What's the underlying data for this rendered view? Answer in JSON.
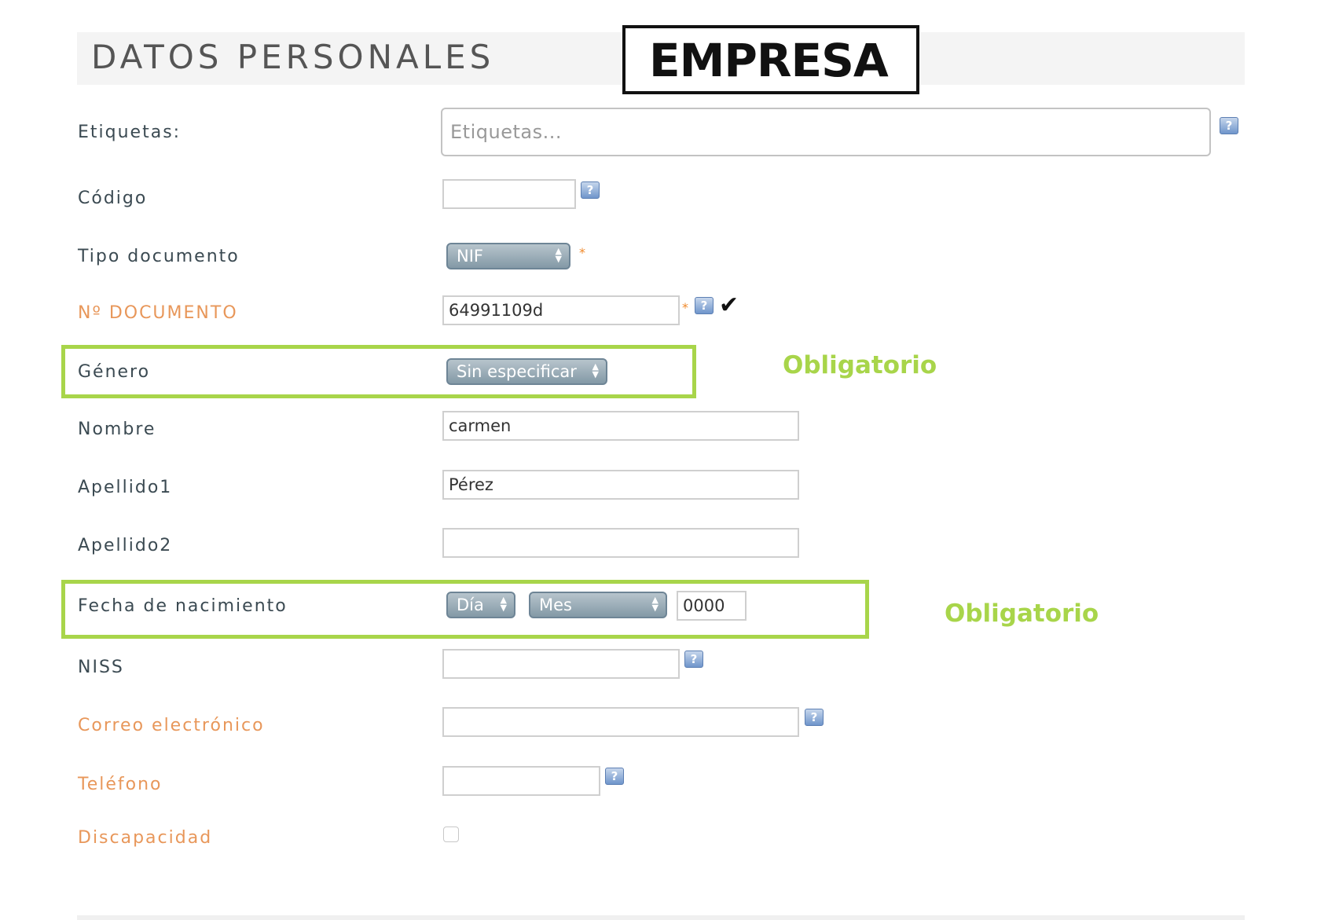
{
  "header": {
    "title": "DATOS PERSONALES",
    "overlay_label": "EMPRESA"
  },
  "fields": {
    "etiquetas": {
      "label": "Etiquetas:",
      "placeholder": "Etiquetas..."
    },
    "codigo": {
      "label": "Código",
      "value": ""
    },
    "tipo_documento": {
      "label": "Tipo documento",
      "selected": "NIF",
      "required_mark": "*"
    },
    "num_documento": {
      "label": "Nº DOCUMENTO",
      "value": "64991109d",
      "required_mark": "*",
      "valid_icon": "checkmark-icon"
    },
    "genero": {
      "label": "Género",
      "selected": "Sin especificar"
    },
    "nombre": {
      "label": "Nombre",
      "value": "carmen"
    },
    "apellido1": {
      "label": "Apellido1",
      "value": "Pérez"
    },
    "apellido2": {
      "label": "Apellido2",
      "value": ""
    },
    "fecha_nacimiento": {
      "label": "Fecha de nacimiento",
      "day": "Día",
      "month": "Mes",
      "year": "0000"
    },
    "niss": {
      "label": "NISS",
      "value": ""
    },
    "correo": {
      "label": "Correo electrónico",
      "value": ""
    },
    "telefono": {
      "label": "Teléfono",
      "value": ""
    },
    "discapacidad": {
      "label": "Discapacidad",
      "checked": false
    }
  },
  "help_icon_glyph": "?",
  "select_arrows": "▲▼",
  "annotations": {
    "genero_note": "Obligatorio",
    "fecha_note": "Obligatorio",
    "highlight_color": "#a8d54a"
  },
  "colors": {
    "label_default": "#3b4a52",
    "label_required": "#e8975a",
    "select_bg": "#8399a6"
  }
}
